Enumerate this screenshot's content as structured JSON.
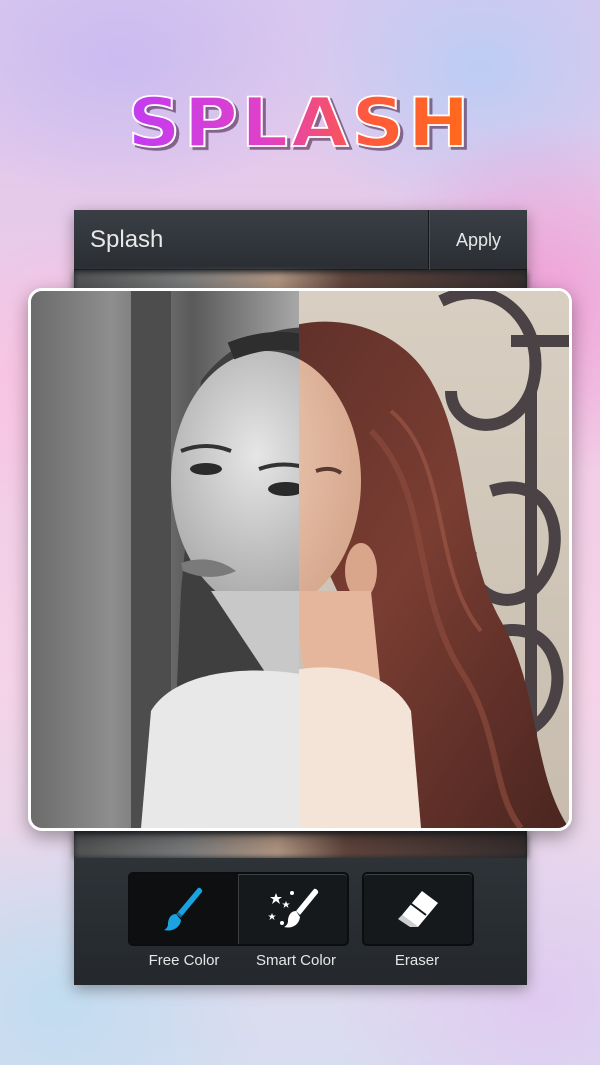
{
  "banner": {
    "title": "SPLASH"
  },
  "header": {
    "title": "Splash",
    "apply_label": "Apply"
  },
  "photo": {
    "description_icon": "portrait-photo"
  },
  "tools": [
    {
      "label": "Free Color",
      "icon": "brush-icon",
      "active": true
    },
    {
      "label": "Smart Color",
      "icon": "magic-wand-icon",
      "active": false
    },
    {
      "label": "Eraser",
      "icon": "eraser-icon",
      "active": false
    }
  ],
  "colors": {
    "brush_accent": "#1aa3e0",
    "panel_dark": "#24282c",
    "title_gradient_start": "#c23cf2",
    "title_gradient_end": "#ff6a1a"
  }
}
